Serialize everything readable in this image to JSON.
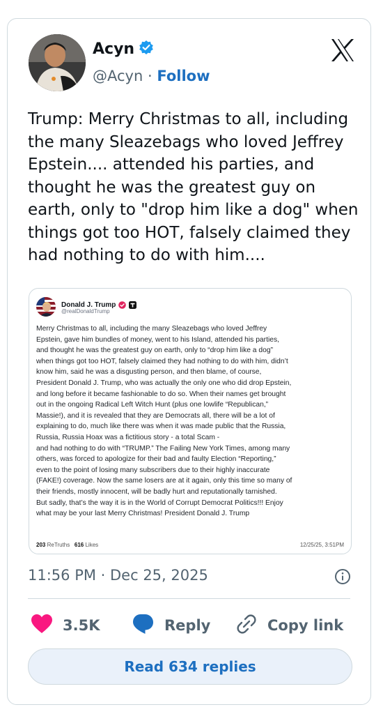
{
  "tweet": {
    "author_name": "Acyn",
    "author_handle": "@Acyn",
    "separator": "·",
    "follow_label": "Follow",
    "text_lines": [
      "Trump: Merry Christmas to all, including",
      "the many Sleazebags who loved Jeffrey",
      "Epstein.... attended his parties, and",
      "thought he was the greatest guy on",
      "earth, only to \"drop him like a dog\" when",
      "things got too HOT, falsely claimed they",
      "had nothing to do with him...."
    ],
    "timestamp": "11:56 PM · Dec 25, 2025"
  },
  "embed": {
    "author_name": "Donald J. Trump",
    "author_handle": "@realDonaldTrump",
    "body_lines": [
      "Merry Christmas to all, including the many Sleazebags who loved Jeffrey",
      "Epstein, gave him bundles of money, went to his Island, attended his parties,",
      "and thought he was the greatest guy on earth, only to “drop him like a dog”",
      "when things got too HOT, falsely claimed they had nothing to do with him, didn’t",
      "know him, said he was a disgusting person, and then blame, of course,",
      "President Donald J. Trump, who was actually the only one who did drop Epstein,",
      "and long before it became fashionable to do so. When their names get brought",
      "out in the ongoing Radical Left Witch Hunt (plus one lowlife “Republican,”",
      "Massie!), and it is revealed that they are Democrats all, there will be a lot of",
      "explaining to do, much like there was when it was made public that the Russia,",
      "Russia, Russia Hoax was a fictitious story - a total Scam -",
      "and had nothing to do with “TRUMP.” The Failing New York Times, among many",
      "others, was forced to apologize for their bad and faulty Election “Reporting,”",
      "even to the point of losing many subscribers due to their highly inaccurate",
      "(FAKE!) coverage. Now the same losers are at it again, only this time so many of",
      "their friends, mostly innocent, will be badly hurt and reputationally tarnished.",
      "But sadly, that’s the way it is in the World of Corrupt Democrat Politics!!! Enjoy",
      "what may be your last Merry Christmas! President Donald J. Trump"
    ],
    "retruths_count": "203",
    "retruths_label": "ReTruths",
    "likes_count": "616",
    "likes_label": "Likes",
    "date": "12/25/25, 3:51PM"
  },
  "actions": {
    "like_count": "3.5K",
    "reply_label": "Reply",
    "copy_label": "Copy link"
  },
  "read_replies_label": "Read 634 replies",
  "colors": {
    "accent": "#1d6fc0",
    "verified": "#1d9bf0",
    "like": "#f91880",
    "muted": "#536471",
    "border": "#cfd9de",
    "button_bg": "#eaf1fa"
  },
  "icons": [
    "verified-badge-icon",
    "x-logo-icon",
    "info-icon",
    "heart-icon",
    "reply-bubble-icon",
    "link-icon",
    "truth-verified-icon",
    "truth-social-icon"
  ]
}
